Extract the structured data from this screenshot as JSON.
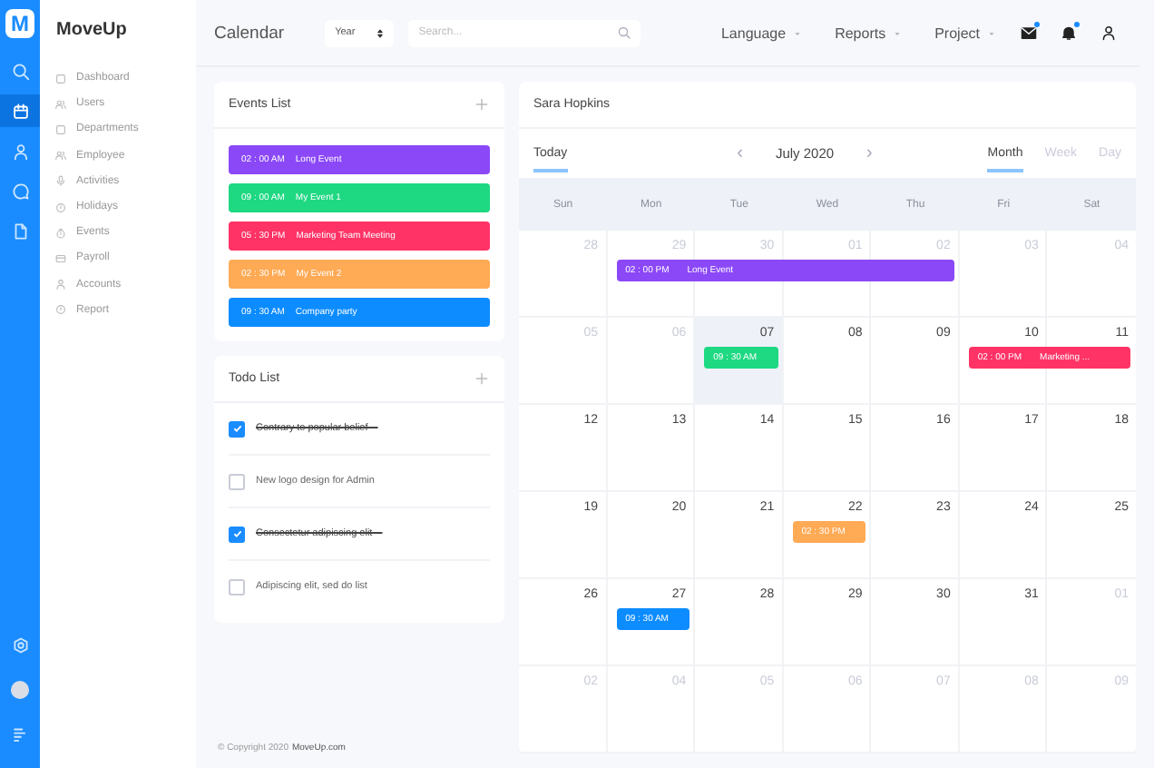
{
  "rail": {
    "logo": "M",
    "items": [
      {
        "selected": false
      },
      {
        "selected": true
      },
      {
        "selected": false
      },
      {
        "selected": false
      },
      {
        "selected": false
      }
    ]
  },
  "brand": "MoveUp",
  "sidebar": {
    "items": [
      {
        "label": "Dashboard"
      },
      {
        "label": "Users"
      },
      {
        "label": "Departments"
      },
      {
        "label": "Employee"
      },
      {
        "label": "Activities"
      },
      {
        "label": "Holidays"
      },
      {
        "label": "Events"
      },
      {
        "label": "Payroll"
      },
      {
        "label": "Accounts"
      },
      {
        "label": "Report"
      }
    ]
  },
  "header": {
    "title": "Calendar",
    "select": "Year",
    "search": {
      "placeholder": "Search..."
    },
    "menus": [
      "Language",
      "Reports",
      "Project"
    ],
    "icons": [
      {
        "dot": true
      },
      {
        "dot": true
      },
      {
        "dot": false
      }
    ]
  },
  "events_list": {
    "title": "Events List",
    "items": [
      {
        "time": "02 : 00 AM",
        "title": "Long Event",
        "color": "#8b48f7"
      },
      {
        "time": "09 : 00 AM",
        "title": "My Event 1",
        "color": "#1ed882"
      },
      {
        "time": "05 : 30 PM",
        "title": "Marketing Team Meeting",
        "color": "#ff3366"
      },
      {
        "time": "02 : 30 PM",
        "title": "My Event 2",
        "color": "#ffaa55"
      },
      {
        "time": "09 : 30 AM",
        "title": "Company party",
        "color": "#0d8cff"
      }
    ]
  },
  "todo_list": {
    "title": "Todo List",
    "items": [
      {
        "text": "Contrary to popular belief---",
        "checked": true
      },
      {
        "text": "New logo design for Admin",
        "checked": false
      },
      {
        "text": "Consectetur adipiscing elit---",
        "checked": true
      },
      {
        "text": "Adipiscing elit, sed do list",
        "checked": false
      }
    ]
  },
  "footer": {
    "copyright": "© Copyright 2020",
    "link": "MoveUp.com"
  },
  "calendar": {
    "user": "Sara Hopkins",
    "today_button": "Today",
    "prev": "‹",
    "month": "July 2020",
    "next": "›",
    "views": [
      {
        "label": "Month",
        "selected": true
      },
      {
        "label": "Week",
        "selected": false
      },
      {
        "label": "Day",
        "selected": false
      }
    ],
    "weekdays": [
      "Sun",
      "Mon",
      "Tue",
      "Wed",
      "Thu",
      "Fri",
      "Sat"
    ],
    "weeks": [
      {
        "days": [
          {
            "d": "28",
            "muted": true,
            "today": false
          },
          {
            "d": "29",
            "muted": true,
            "today": false,
            "events": [
              {
                "time": "02 : 00 PM",
                "title": "Long Event",
                "color": "#8b48f7"
              }
            ]
          },
          {
            "d": "30",
            "muted": true,
            "today": false
          },
          {
            "d": "01",
            "muted": true,
            "today": false
          },
          {
            "d": "02",
            "muted": true,
            "today": false
          },
          {
            "d": "03",
            "muted": true,
            "today": false
          },
          {
            "d": "04",
            "muted": true,
            "today": false
          }
        ]
      },
      {
        "days": [
          {
            "d": "05",
            "muted": true,
            "today": false
          },
          {
            "d": "06",
            "muted": true,
            "today": false
          },
          {
            "d": "07",
            "muted": false,
            "today": true,
            "events": [
              {
                "time": "09 : 30 AM",
                "color": "#1ed882"
              }
            ]
          },
          {
            "d": "08",
            "muted": false,
            "today": false
          },
          {
            "d": "09",
            "muted": false,
            "today": false
          },
          {
            "d": "10",
            "muted": false,
            "today": false,
            "events": [
              {
                "time": "02 : 00 PM",
                "title": "Marketing ...",
                "color": "#ff3366"
              }
            ]
          },
          {
            "d": "11",
            "muted": false,
            "today": false
          }
        ]
      },
      {
        "days": [
          {
            "d": "12",
            "muted": false,
            "today": false
          },
          {
            "d": "13",
            "muted": false,
            "today": false
          },
          {
            "d": "14",
            "muted": false,
            "today": false
          },
          {
            "d": "15",
            "muted": false,
            "today": false
          },
          {
            "d": "16",
            "muted": false,
            "today": false
          },
          {
            "d": "17",
            "muted": false,
            "today": false
          },
          {
            "d": "18",
            "muted": false,
            "today": false
          }
        ]
      },
      {
        "days": [
          {
            "d": "19",
            "muted": false,
            "today": false
          },
          {
            "d": "20",
            "muted": false,
            "today": false
          },
          {
            "d": "21",
            "muted": false,
            "today": false
          },
          {
            "d": "22",
            "muted": false,
            "today": false,
            "events": [
              {
                "time": "02 : 30 PM",
                "color": "#ffaa55"
              }
            ]
          },
          {
            "d": "23",
            "muted": false,
            "today": false
          },
          {
            "d": "24",
            "muted": false,
            "today": false
          },
          {
            "d": "25",
            "muted": false,
            "today": false
          }
        ]
      },
      {
        "days": [
          {
            "d": "26",
            "muted": false,
            "today": false
          },
          {
            "d": "27",
            "muted": false,
            "today": false,
            "events": [
              {
                "time": "09 : 30 AM",
                "color": "#0d8cff"
              }
            ]
          },
          {
            "d": "28",
            "muted": false,
            "today": false
          },
          {
            "d": "29",
            "muted": false,
            "today": false
          },
          {
            "d": "30",
            "muted": false,
            "today": false
          },
          {
            "d": "31",
            "muted": false,
            "today": false
          },
          {
            "d": "01",
            "muted": true,
            "today": false
          }
        ]
      },
      {
        "days": [
          {
            "d": "02",
            "muted": true,
            "today": false
          },
          {
            "d": "04",
            "muted": true,
            "today": false
          },
          {
            "d": "05",
            "muted": true,
            "today": false
          },
          {
            "d": "06",
            "muted": true,
            "today": false
          },
          {
            "d": "07",
            "muted": true,
            "today": false
          },
          {
            "d": "08",
            "muted": true,
            "today": false
          },
          {
            "d": "09",
            "muted": true,
            "today": false
          }
        ]
      }
    ]
  }
}
